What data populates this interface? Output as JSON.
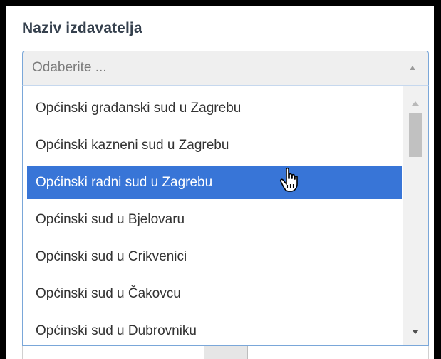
{
  "field": {
    "label": "Naziv izdavatelja",
    "placeholder": "Odaberite ..."
  },
  "dropdown": {
    "options": [
      {
        "label": "Općinski građanski sud u Zagrebu"
      },
      {
        "label": "Općinski kazneni sud u Zagrebu"
      },
      {
        "label": "Općinski radni sud u Zagrebu",
        "highlighted": true
      },
      {
        "label": "Općinski sud u Bjelovaru"
      },
      {
        "label": "Općinski sud u Crikvenici"
      },
      {
        "label": "Općinski sud u Čakovcu"
      },
      {
        "label": "Općinski sud u Dubrovniku"
      }
    ],
    "highlight_color": "#3875d7"
  },
  "icons": {
    "select_arrow": "chevron-up-icon",
    "cursor": "hand-pointer-icon",
    "scroll_up": "scroll-up-arrow-icon",
    "scroll_down": "scroll-down-arrow-icon"
  }
}
